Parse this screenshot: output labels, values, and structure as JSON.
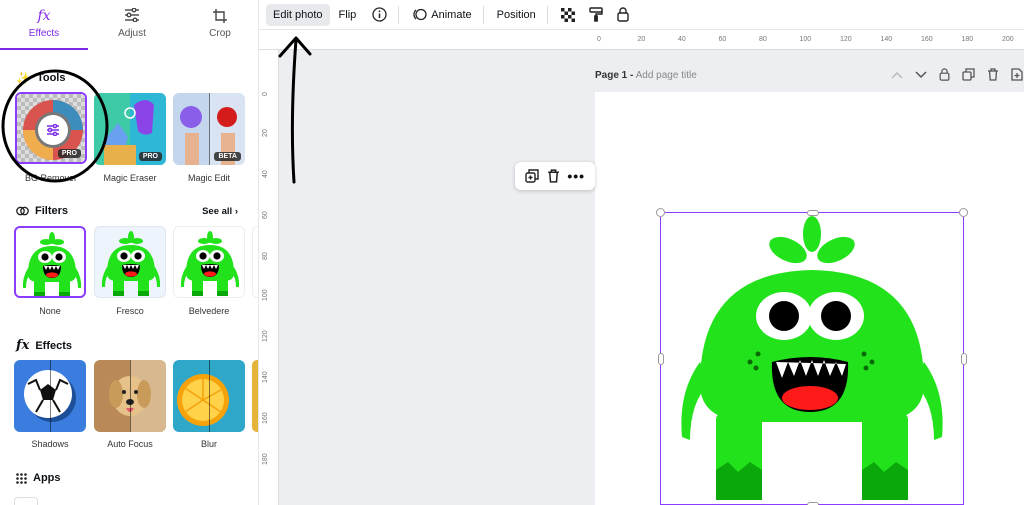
{
  "panel": {
    "tabs": [
      {
        "label": "Effects",
        "icon": "fx-icon",
        "active": true
      },
      {
        "label": "Adjust",
        "icon": "sliders-icon",
        "active": false
      },
      {
        "label": "Crop",
        "icon": "crop-icon",
        "active": false
      }
    ],
    "tools": {
      "title": "Tools",
      "items": [
        {
          "label": "BG Remover",
          "badge": "PRO"
        },
        {
          "label": "Magic Eraser",
          "badge": "PRO"
        },
        {
          "label": "Magic Edit",
          "badge": "BETA"
        }
      ]
    },
    "filters": {
      "title": "Filters",
      "see_all": "See all",
      "items": [
        {
          "label": "None"
        },
        {
          "label": "Fresco"
        },
        {
          "label": "Belvedere"
        }
      ]
    },
    "effects": {
      "title": "Effects",
      "items": [
        {
          "label": "Shadows"
        },
        {
          "label": "Auto Focus"
        },
        {
          "label": "Blur"
        }
      ]
    },
    "apps": {
      "title": "Apps"
    }
  },
  "toolbar": {
    "edit_photo": "Edit photo",
    "flip": "Flip",
    "animate": "Animate",
    "position": "Position"
  },
  "ruler": {
    "top_ticks": [
      "0",
      "20",
      "40",
      "60",
      "80",
      "100",
      "120",
      "140",
      "160",
      "180",
      "200"
    ],
    "left_ticks": [
      "0",
      "20",
      "40",
      "60",
      "80",
      "100",
      "120",
      "140",
      "160",
      "180"
    ]
  },
  "page": {
    "label": "Page 1 -",
    "title_placeholder": "Add page title"
  },
  "colors": {
    "accent": "#7d2ae8",
    "selection": "#8b3dff",
    "monster_green": "#22e21b",
    "monster_dark_green": "#0aa80a",
    "mouth_red": "#ff1a1a"
  }
}
